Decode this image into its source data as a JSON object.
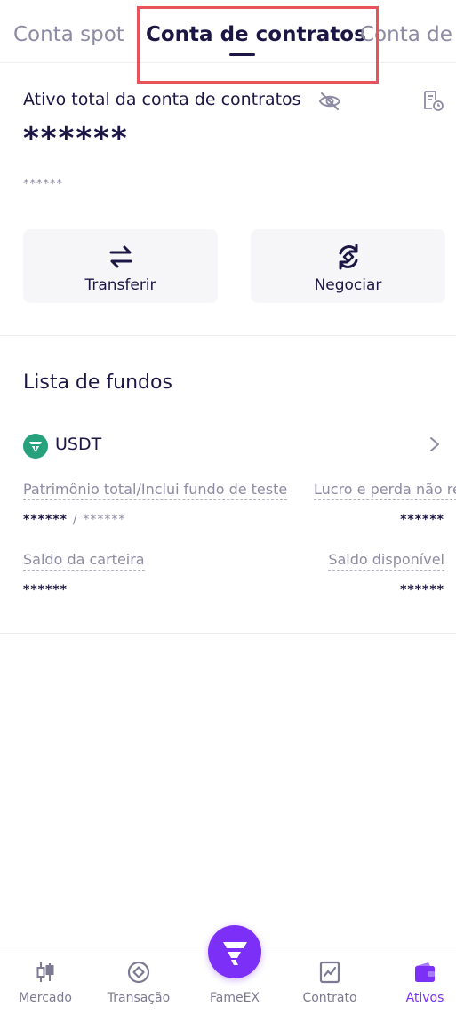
{
  "tabs": [
    {
      "label": "Conta spot"
    },
    {
      "label": "Conta de contratos"
    },
    {
      "label": "Conta de"
    }
  ],
  "asset": {
    "title": "Ativo total da conta de contratos",
    "value": "******",
    "sub_value": "******"
  },
  "actions": {
    "transfer_label": "Transferir",
    "trade_label": "Negociar"
  },
  "funds": {
    "title": "Lista de fundos",
    "coin": "USDT",
    "equity_label": "Patrimônio total/Inclui fundo de teste",
    "pnl_label": "Lucro e perda não re",
    "equity_value": "******",
    "equity_sep": "/",
    "equity_test_value": "******",
    "pnl_value": "******",
    "wallet_label": "Saldo da carteira",
    "available_label": "Saldo disponível",
    "wallet_value": "******",
    "available_value": "******"
  },
  "nav": {
    "market": "Mercado",
    "trade": "Transação",
    "brand": "FameEX",
    "contract": "Contrato",
    "assets": "Ativos"
  },
  "colors": {
    "primary_text": "#1c1645",
    "muted_text": "#8d8ba3",
    "accent": "#7b2ff7",
    "highlight": "#e8535a",
    "usdt": "#26a17b"
  }
}
